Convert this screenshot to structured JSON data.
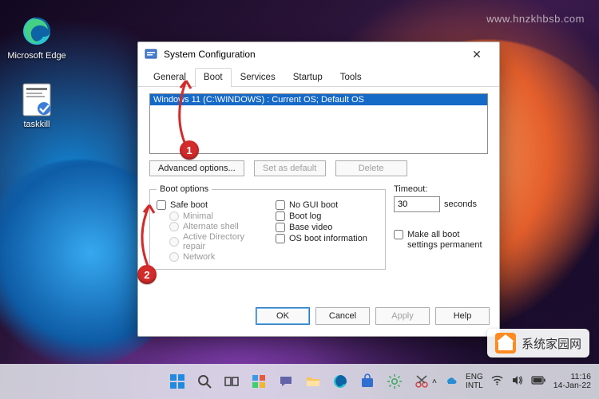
{
  "desktop": {
    "icons": [
      {
        "name": "edge",
        "label": "Microsoft Edge"
      },
      {
        "name": "taskkill",
        "label": "taskkill"
      }
    ]
  },
  "watermark": "www.hnzkhbsb.com",
  "brand": "系统家园网",
  "dialog": {
    "title": "System Configuration",
    "tabs": [
      "General",
      "Boot",
      "Services",
      "Startup",
      "Tools"
    ],
    "active_tab": "Boot",
    "boot_entry": "Windows 11 (C:\\WINDOWS) : Current OS; Default OS",
    "buttons": {
      "advanced": "Advanced options...",
      "set_default": "Set as default",
      "delete": "Delete"
    },
    "boot_options_legend": "Boot options",
    "safe_boot": "Safe boot",
    "radios": {
      "minimal": "Minimal",
      "alt_shell": "Alternate shell",
      "ad_repair": "Active Directory repair",
      "network": "Network"
    },
    "checks": {
      "no_gui": "No GUI boot",
      "boot_log": "Boot log",
      "base_video": "Base video",
      "os_info": "OS boot information"
    },
    "timeout_label": "Timeout:",
    "timeout_value": "30",
    "timeout_unit": "seconds",
    "make_permanent": "Make all boot settings permanent",
    "dlg_buttons": {
      "ok": "OK",
      "cancel": "Cancel",
      "apply": "Apply",
      "help": "Help"
    }
  },
  "annotations": {
    "1": "1",
    "2": "2"
  },
  "tray": {
    "time": "11:16",
    "date": "14-Jan-22"
  }
}
